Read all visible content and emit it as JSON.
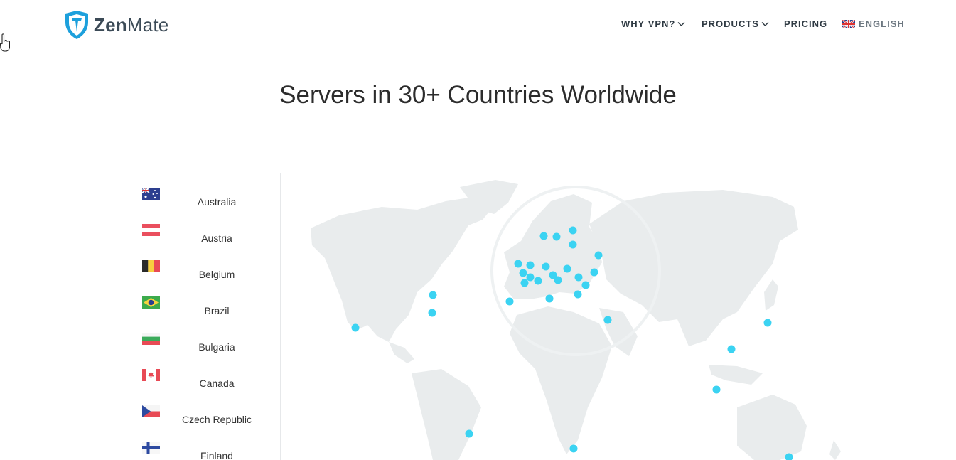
{
  "brand": {
    "name_part1": "Zen",
    "name_part2": "Mate"
  },
  "nav": {
    "items": [
      {
        "label": "WHY VPN?",
        "dropdown": true
      },
      {
        "label": "PRODUCTS",
        "dropdown": true
      },
      {
        "label": "PRICING",
        "dropdown": false
      }
    ],
    "language": "ENGLISH"
  },
  "section": {
    "title": "Servers in 30+ Countries Worldwide"
  },
  "countries": [
    {
      "name": "Australia"
    },
    {
      "name": "Austria"
    },
    {
      "name": "Belgium"
    },
    {
      "name": "Brazil"
    },
    {
      "name": "Bulgaria"
    },
    {
      "name": "Canada"
    },
    {
      "name": "Czech Republic"
    },
    {
      "name": "Finland"
    }
  ],
  "colors": {
    "accent": "#3bd3f2",
    "land": "#e9eced",
    "text": "#333333",
    "logo": "#1da0dc"
  }
}
